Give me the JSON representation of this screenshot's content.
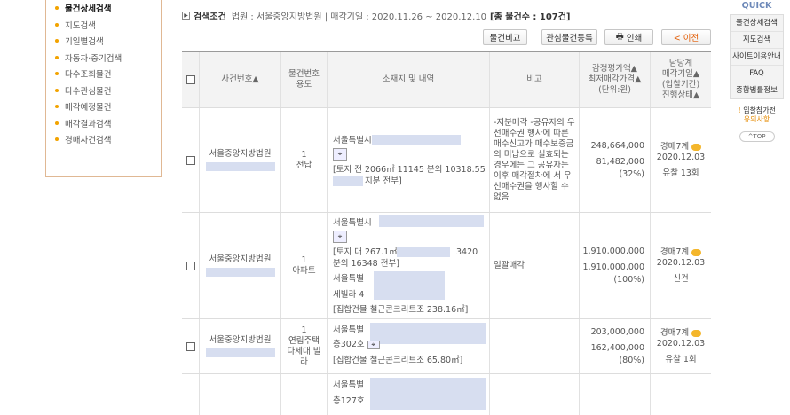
{
  "left_menu": [
    {
      "label": "물건상세검색",
      "active": true
    },
    {
      "label": "지도검색"
    },
    {
      "label": "기일별검색"
    },
    {
      "label": "자동차·중기검색"
    },
    {
      "label": "다수조회물건"
    },
    {
      "label": "다수관심물건"
    },
    {
      "label": "매각예정물건"
    },
    {
      "label": "매각결과검색"
    },
    {
      "label": "경매사건검색"
    }
  ],
  "condition": {
    "label": "검색조건",
    "text": "법원 : 서울중앙지방법원 | 매각기일 : 2020.11.26 ~ 2020.12.10",
    "total": "[총 물건수 : 107건]"
  },
  "toolbar": {
    "compare": "물건비교",
    "watch": "관심물건등록",
    "print": "인쇄",
    "prev": "< 이전"
  },
  "headers": {
    "case_no": "사건번호▲",
    "item_no_1": "물건번호",
    "item_no_2": "용도",
    "location": "소재지 및 내역",
    "note": "비고",
    "price_1": "감정평가액▲",
    "price_2": "최저매각가격▲",
    "price_3": "(단위:원)",
    "status_1": "담당계",
    "status_2": "매각기일▲",
    "status_3": "(입찰기간)",
    "status_4": "진행상태▲"
  },
  "rows": [
    {
      "court": "서울중앙지방법원",
      "item_no": "1",
      "use": "전답",
      "addr1": "서울특별시",
      "addr2": "[토지 전 2066㎡ 11145 분의 10318.55",
      "addr3": "지분 전부]",
      "note": "-지분매각 -공유자의 우선매수권 행사에 따른 매수신고가 매수보증금의 미납으로 실효되는 경우에는 그 공유자는 이후 매각절차에 서 우선매수권을 행사할 수 없음",
      "appraisal": "248,664,000",
      "minimum": "81,482,000",
      "ratio": "(32%)",
      "dept": "경매7계",
      "date": "2020.12.03",
      "status": "유찰 13회"
    },
    {
      "court": "서울중앙지방법원",
      "item_no": "1",
      "use": "아파트",
      "addr1": "서울특별시",
      "addr2": "[토지 대 267.1㎡",
      "addr2b": "3420",
      "addr3": "분의 16348 전부]",
      "addr4": "서울특별",
      "addr5": "세빌라 4",
      "addr6": "[집합건물 철근콘크리트조 238.16㎡]",
      "note": "일괄매각",
      "appraisal": "1,910,000,000",
      "minimum": "1,910,000,000",
      "ratio": "(100%)",
      "dept": "경매7계",
      "date": "2020.12.03",
      "status": "신건"
    },
    {
      "court": "서울중앙지방법원",
      "item_no": "1",
      "use": "연립주택 다세대 빌라",
      "addr1": "서울특별",
      "addr2": "층302호",
      "addr3": "[집합건물 철근콘크리트조 65.80㎡]",
      "note": "",
      "appraisal": "203,000,000",
      "minimum": "162,400,000",
      "ratio": "(80%)",
      "dept": "경매7계",
      "date": "2020.12.03",
      "status": "유찰 1회"
    },
    {
      "addr1": "서울특별",
      "addr2": "층127호"
    }
  ],
  "quick": {
    "title": "QUICK",
    "items": [
      "물건상세검색",
      "지도검색",
      "사이트이용안내",
      "FAQ",
      "종합법률정보"
    ],
    "warn_1": "입찰참가전",
    "warn_2": "유의사항",
    "top": "^TOP"
  }
}
